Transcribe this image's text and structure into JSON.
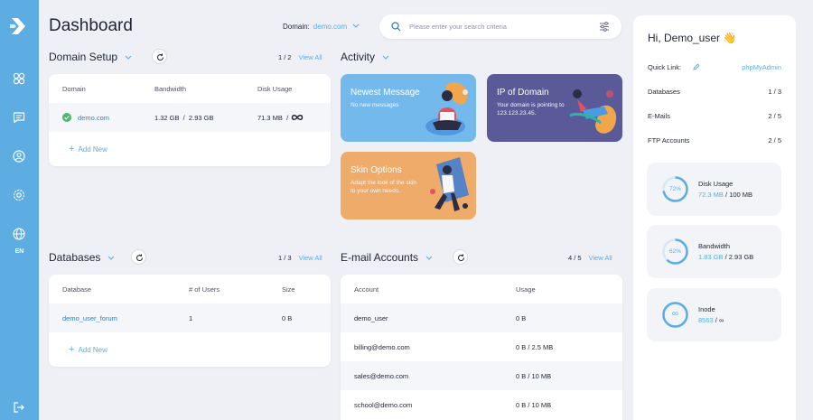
{
  "app": {
    "title": "Dashboard",
    "language": "EN"
  },
  "sidebar": {
    "items": [
      {
        "icon": "apps-icon"
      },
      {
        "icon": "message-icon"
      },
      {
        "icon": "user-icon"
      },
      {
        "icon": "settings-icon"
      },
      {
        "icon": "globe-icon"
      }
    ]
  },
  "header": {
    "domain_label": "Domain:",
    "domain_value": "demo.com",
    "search_placeholder": "Please enter your search criteria"
  },
  "domain_setup": {
    "title": "Domain Setup",
    "pager": "1 / 2",
    "view_all": "View All",
    "columns": [
      "Domain",
      "Bandwidth",
      "Disk Usage"
    ],
    "rows": [
      {
        "domain": "demo.com",
        "bandwidth": "1.32 GB  /  2.93 GB",
        "disk": "71.3 MB  /"
      }
    ],
    "add_new": "Add New"
  },
  "activity": {
    "title": "Activity",
    "tiles": [
      {
        "title": "Newest Message",
        "sub": "No new messages",
        "color": "#74b9ec"
      },
      {
        "title": "IP of Domain",
        "sub": "Your domain is pointing to\n123.123.23.45.",
        "color": "#5b5a99"
      },
      {
        "title": "Skin Options",
        "sub": "Adapt the look of the skin\nto your own needs.",
        "color": "#efab6a"
      }
    ]
  },
  "databases": {
    "title": "Databases",
    "pager": "1 / 3",
    "view_all": "View All",
    "columns": [
      "Database",
      "# of Users",
      "Size"
    ],
    "rows": [
      {
        "name": "demo_user_forum",
        "users": "1",
        "size": "0 B"
      }
    ],
    "add_new": "Add New"
  },
  "email_accounts": {
    "title": "E-mail Accounts",
    "pager": "4 / 5",
    "view_all": "View All",
    "columns": [
      "Account",
      "Usage"
    ],
    "rows": [
      {
        "account": "demo_user",
        "usage": "0 B"
      },
      {
        "account": "billing@demo.com",
        "usage": "0 B / 2.5 MB"
      },
      {
        "account": "sales@demo.com",
        "usage": "0 B / 10 MB"
      },
      {
        "account": "school@demo.com",
        "usage": "0 B / 10 MB"
      }
    ]
  },
  "user_panel": {
    "greeting": "Hi, Demo_user 👋",
    "quick_link_label": "Quick Link:",
    "quick_link_value": "phpMyAdmin",
    "stats": [
      {
        "label": "Databases",
        "value": "1 / 3"
      },
      {
        "label": "E-Mails",
        "value": "2 / 5"
      },
      {
        "label": "FTP Accounts",
        "value": "2 / 5"
      }
    ],
    "usage": [
      {
        "label": "Disk Usage",
        "percent_text": "72%",
        "fraction": 0.72,
        "used": "72.3 MB",
        "total": "100 MB"
      },
      {
        "label": "Bandwidth",
        "percent_text": "62%",
        "fraction": 0.62,
        "used": "1.83 GB",
        "total": "2.93 GB"
      },
      {
        "label": "Inode",
        "percent_text": "∞",
        "fraction": 0,
        "used": "8563",
        "total": "∞"
      }
    ]
  },
  "colors": {
    "accent": "#5dade2",
    "sidebar": "#5dade2",
    "success": "#4cb86b"
  }
}
